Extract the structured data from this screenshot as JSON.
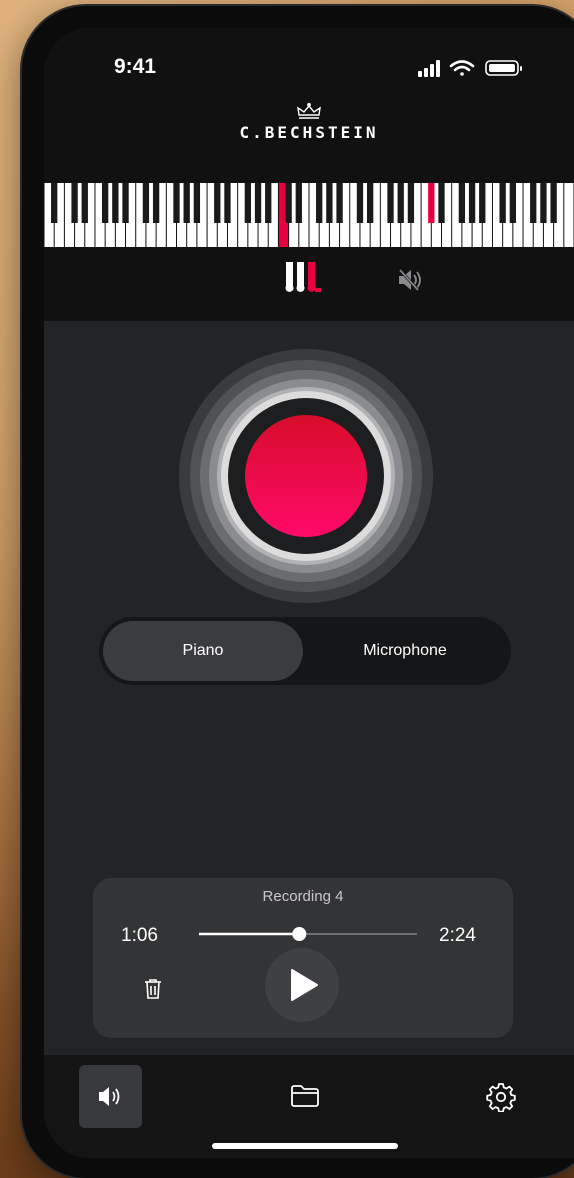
{
  "status_bar": {
    "time": "9:41"
  },
  "brand": {
    "name": "C.BECHSTEIN"
  },
  "mode_icons": {
    "keys_icon": "piano-keys-icon",
    "mute_icon": "speaker-muted-icon"
  },
  "input_toggle": {
    "options": [
      "Piano",
      "Microphone"
    ],
    "selected": "Piano"
  },
  "player": {
    "title": "Recording 4",
    "elapsed": "1:06",
    "total": "2:24",
    "progress": 0.46
  },
  "bottom_nav": {
    "items": [
      "speaker-icon",
      "folder-icon",
      "gear-icon"
    ],
    "active": "speaker-icon"
  },
  "colors": {
    "accent": "#e8003f",
    "screen_bg": "#232426",
    "panel_bg": "#333436"
  }
}
